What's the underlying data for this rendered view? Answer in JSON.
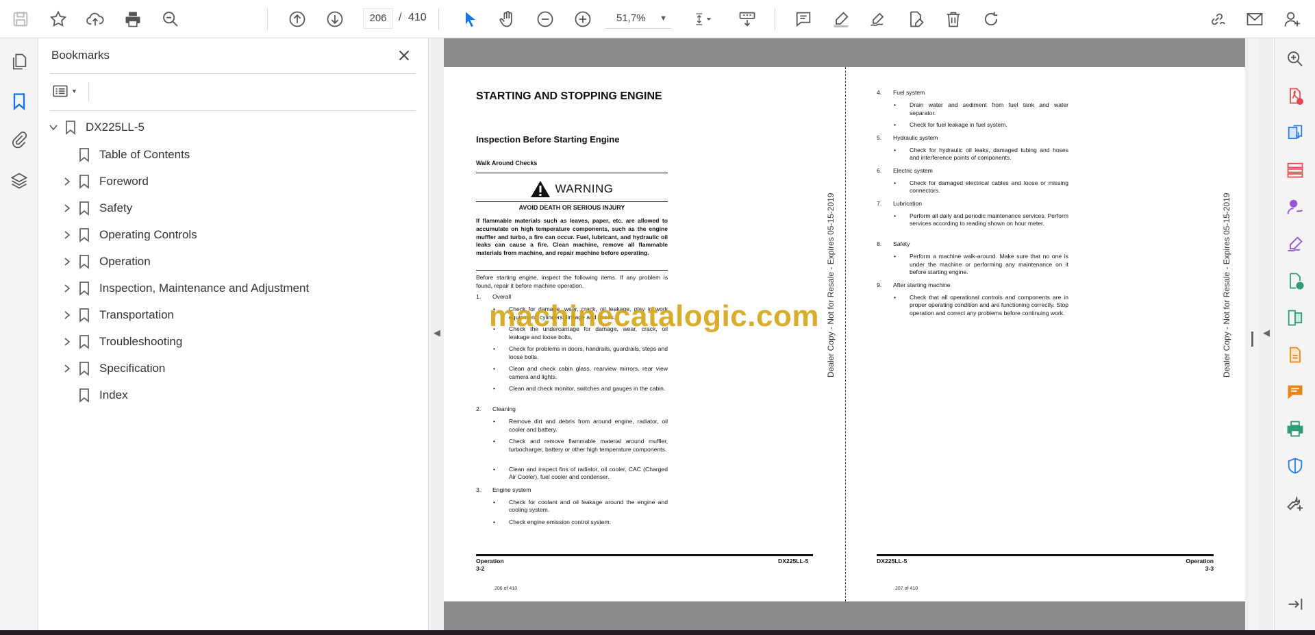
{
  "toolbar": {
    "current_page": "206",
    "page_separator": "/",
    "total_pages": "410",
    "zoom": "51,7%",
    "icons": [
      "save-icon",
      "bookmark-star-icon",
      "upload-icon",
      "print-icon",
      "find-zoom-icon",
      "page-up-icon",
      "page-down-icon",
      "select-cursor-icon",
      "hand-icon",
      "zoom-out-icon",
      "zoom-in-icon",
      "fit-page-icon",
      "scroll-mode-icon",
      "comment-icon",
      "highlight-icon",
      "sign-icon",
      "fill-sign-icon",
      "delete-icon",
      "rotate-icon",
      "share-link-icon",
      "email-icon",
      "account-icon"
    ]
  },
  "left_rail": {
    "icons": [
      "page-thumbnails-icon",
      "bookmarks-icon",
      "attachments-icon",
      "layers-icon"
    ]
  },
  "bookmarks": {
    "title": "Bookmarks",
    "root": "DX225LL-5",
    "items": [
      {
        "label": "Table of Contents",
        "expandable": false
      },
      {
        "label": "Foreword",
        "expandable": true
      },
      {
        "label": "Safety",
        "expandable": true
      },
      {
        "label": "Operating Controls",
        "expandable": true
      },
      {
        "label": "Operation",
        "expandable": true
      },
      {
        "label": "Inspection, Maintenance and Adjustment",
        "expandable": true
      },
      {
        "label": "Transportation",
        "expandable": true
      },
      {
        "label": "Troubleshooting",
        "expandable": true
      },
      {
        "label": "Specification",
        "expandable": true
      },
      {
        "label": "Index",
        "expandable": false
      }
    ]
  },
  "document": {
    "left": {
      "title": "STARTING AND STOPPING ENGINE",
      "subtitle": "Inspection Before Starting Engine",
      "section": "Walk Around Checks",
      "warning_word": "WARNING",
      "warning_sub": "AVOID DEATH OR SERIOUS INJURY",
      "warning_text": "If flammable materials such as leaves, paper, etc. are allowed to accumulate on high temperature components, such as the engine muffler and turbo, a fire can occur. Fuel, lubricant, and hydraulic oil leaks can cause a fire. Clean machine, remove all flammable materials from machine, and repair machine before operating.",
      "intro": "Before starting engine, inspect the following items. If any problem is found, repair it before machine operation.",
      "list": [
        {
          "num": "1.",
          "head": "Overall",
          "bullets": [
            "Check for damage, wear, crack, oil leakage, play in work equipment, cylinders, linkage and hoses.",
            "Check the undercarriage for damage, wear, crack, oil leakage and loose bolts.",
            "Check for problems in doors, handrails, guardrails, steps and loose bolts.",
            "Clean and check cabin glass, rearview mirrors, rear view camera and lights.",
            "Clean and check monitor, switches and gauges in the cabin."
          ]
        },
        {
          "num": "2.",
          "head": "Cleaning",
          "bullets": [
            "Remove dirt and debris from around engine, radiator, oil cooler and battery.",
            "Check and remove flammable material around muffler, turbocharger, battery or other high temperature components.",
            "Clean and inspect fins of radiator, oil cooler, CAC (Charged Air Cooler), fuel cooler and condenser."
          ]
        },
        {
          "num": "3.",
          "head": "Engine system",
          "bullets": [
            "Check for coolant and oil leakage around the engine and cooling system.",
            "Check engine emission control system."
          ]
        }
      ],
      "footer_left_1": "Operation",
      "footer_left_2": "3-2",
      "footer_right": "DX225LL-5",
      "page_count": "206 of 410"
    },
    "right": {
      "list": [
        {
          "num": "4.",
          "head": "Fuel system",
          "bullets": [
            "Drain water and sediment from fuel tank and water separator.",
            "Check for fuel leakage in fuel system."
          ]
        },
        {
          "num": "5.",
          "head": "Hydraulic system",
          "bullets": [
            "Check for hydraulic oil leaks, damaged tubing and hoses and interference points of components."
          ]
        },
        {
          "num": "6.",
          "head": "Electric system",
          "bullets": [
            "Check for damaged electrical cables and loose or missing connectors."
          ]
        },
        {
          "num": "7.",
          "head": "Lubrication",
          "bullets": [
            "Perform all daily and periodic maintenance services. Perform services according to reading shown on hour meter."
          ]
        },
        {
          "num": "8.",
          "head": "Safety",
          "bullets": [
            "Perform a machine walk-around. Make sure that no one is under the machine or performing any maintenance on it before starting engine."
          ]
        },
        {
          "num": "9.",
          "head": "After starting machine",
          "bullets": [
            "Check that all operational controls and components are in proper operating condition and are functioning correctly. Stop operation and correct any problems before continuing work."
          ]
        }
      ],
      "footer_left": "DX225LL-5",
      "footer_right_1": "Operation",
      "footer_right_2": "3-3",
      "page_count": "207 of 410"
    },
    "stamp": "Dealer Copy - Not for Resale - Expires 05-15-2019",
    "watermark": "machinecatalogic.com"
  },
  "right_rail": {
    "icons": [
      "search-zoom-icon",
      "export-pdf-icon",
      "create-pdf-icon",
      "organize-pages-icon",
      "request-signature-icon",
      "fill-sign-icon",
      "send-review-icon",
      "compare-files-icon",
      "export-file-icon",
      "comment-icon",
      "print-production-icon",
      "protect-icon",
      "more-tools-icon",
      "collapse-panel-icon"
    ]
  },
  "colors": {
    "accent": "#1473e6",
    "watermark": "#d4a71a",
    "tool_red": "#e34850",
    "tool_purple": "#9256d9",
    "tool_blue": "#2c7ce5",
    "tool_green": "#2d9d78",
    "tool_yellow": "#e68619"
  }
}
